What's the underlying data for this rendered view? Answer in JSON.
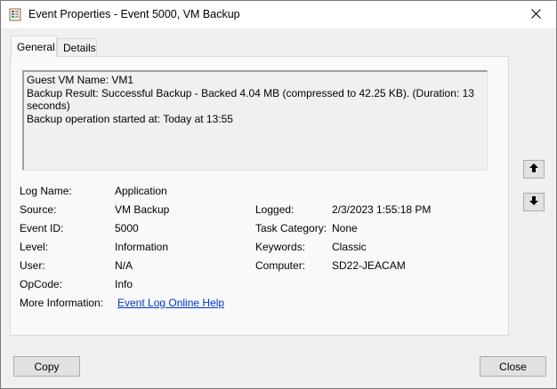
{
  "window": {
    "title": "Event Properties - Event 5000, VM Backup",
    "icon": "event-viewer-icon",
    "close_icon": "close-icon"
  },
  "tabs": [
    {
      "label": "General",
      "active": true
    },
    {
      "label": "Details",
      "active": false
    }
  ],
  "description": {
    "lines": [
      "Guest VM Name: VM1",
      "Backup Result: Successful Backup - Backed 4.04 MB (compressed to 42.25 KB). (Duration: 13",
      "seconds)",
      "Backup operation started at: Today at 13:55"
    ]
  },
  "fields": {
    "log_name": {
      "label": "Log Name:",
      "value": "Application"
    },
    "source": {
      "label": "Source:",
      "value": "VM Backup"
    },
    "event_id": {
      "label": "Event ID:",
      "value": "5000"
    },
    "level": {
      "label": "Level:",
      "value": "Information"
    },
    "user": {
      "label": "User:",
      "value": "N/A"
    },
    "opcode": {
      "label": "OpCode:",
      "value": "Info"
    },
    "more_info": {
      "label": "More Information:",
      "value": "Event Log Online Help"
    },
    "logged": {
      "label": "Logged:",
      "value": "2/3/2023 1:55:18 PM"
    },
    "task_category": {
      "label": "Task Category:",
      "value": "None"
    },
    "keywords": {
      "label": "Keywords:",
      "value": "Classic"
    },
    "computer": {
      "label": "Computer:",
      "value": "SD22-JEACAM"
    }
  },
  "nav": {
    "up_icon": "arrow-up-icon",
    "down_icon": "arrow-down-icon"
  },
  "buttons": {
    "copy": "Copy",
    "close": "Close"
  },
  "colors": {
    "link": "#0033cc",
    "dialog_bg": "#f0f0f0"
  }
}
